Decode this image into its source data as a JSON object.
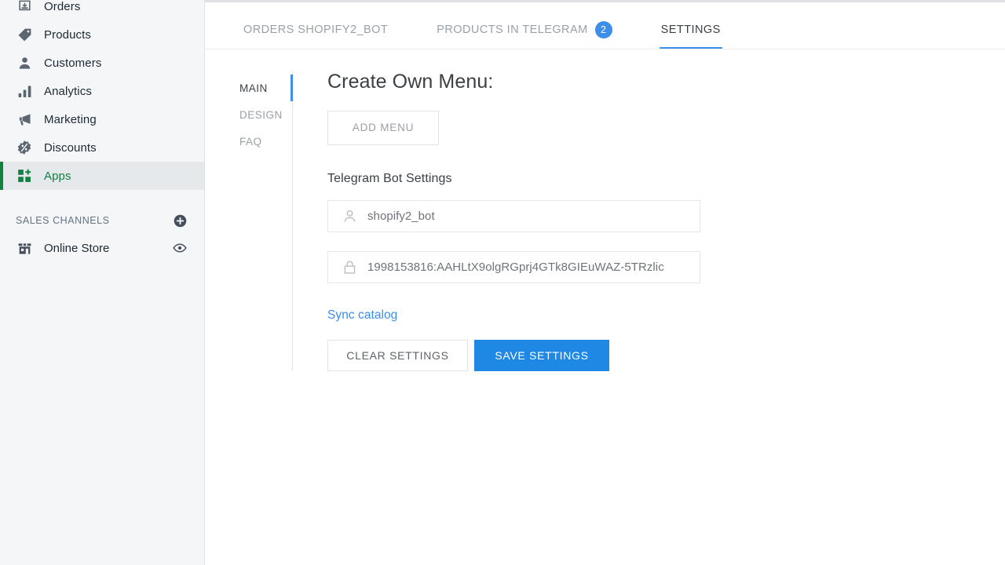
{
  "sidebar": {
    "nav_items": [
      {
        "label": "Orders",
        "icon": "orders-inbox-icon",
        "active": false
      },
      {
        "label": "Products",
        "icon": "tag-icon",
        "active": false
      },
      {
        "label": "Customers",
        "icon": "person-icon",
        "active": false
      },
      {
        "label": "Analytics",
        "icon": "bar-chart-icon",
        "active": false
      },
      {
        "label": "Marketing",
        "icon": "megaphone-icon",
        "active": false
      },
      {
        "label": "Discounts",
        "icon": "discount-badge-icon",
        "active": false
      },
      {
        "label": "Apps",
        "icon": "apps-grid-plus-icon",
        "active": true
      }
    ],
    "sales_channels": {
      "title": "SALES CHANNELS",
      "add_icon": "plus-circle-icon",
      "items": [
        {
          "label": "Online Store",
          "icon": "storefront-icon",
          "action_icon": "eye-icon"
        }
      ]
    },
    "accent_color": "#108043",
    "active_bg": "#e6e9ec"
  },
  "tabs": [
    {
      "label": "ORDERS SHOPIFY2_BOT",
      "badge": null,
      "active": false
    },
    {
      "label": "PRODUCTS IN TELEGRAM",
      "badge": "2",
      "active": false
    },
    {
      "label": "SETTINGS",
      "badge": null,
      "active": true
    }
  ],
  "vertical_tabs": [
    {
      "label": "MAIN",
      "active": true
    },
    {
      "label": "DESIGN",
      "active": false
    },
    {
      "label": "FAQ",
      "active": false
    }
  ],
  "main": {
    "page_title": "Create Own Menu:",
    "add_menu_label": "ADD MENU",
    "bot_settings_title": "Telegram Bot Settings",
    "fields": [
      {
        "name": "bot-username",
        "icon": "person-outline-icon",
        "value": "shopify2_bot"
      },
      {
        "name": "bot-token",
        "icon": "lock-outline-icon",
        "value": "1998153816:AAHLtX9olgRGprj4GTk8GIEuWAZ-5TRzlic"
      }
    ],
    "sync_link_label": "Sync catalog",
    "clear_button_label": "CLEAR SETTINGS",
    "save_button_label": "SAVE SETTINGS"
  },
  "colors": {
    "accent_blue": "#1f88e5",
    "tab_underline": "#3b8eea",
    "badge_blue": "#3b8eea",
    "link_blue": "#3b8eea",
    "shopify_green": "#108043"
  }
}
